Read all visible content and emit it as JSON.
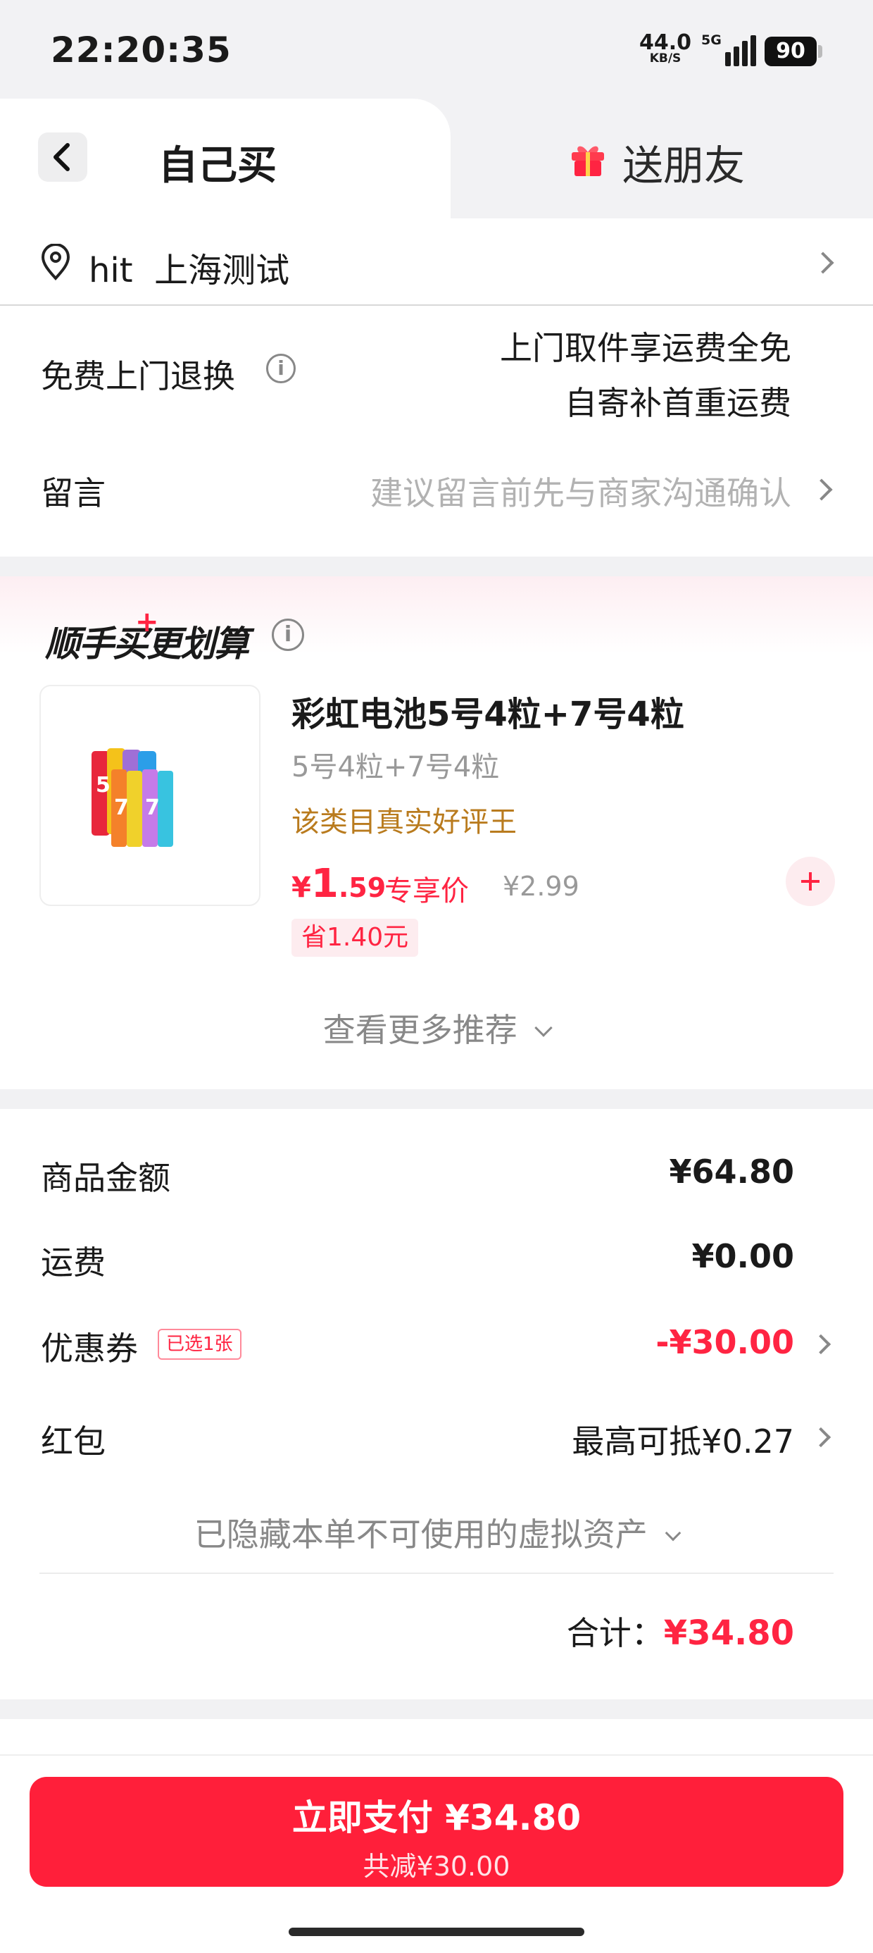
{
  "status_bar": {
    "time": "22:20:35",
    "net_speed": "44.0",
    "net_unit": "KB/S",
    "network": "5G",
    "battery": "90"
  },
  "tabs": {
    "self_buy": "自己买",
    "gift_friend": "送朋友"
  },
  "address": {
    "text": "hit  上海测试"
  },
  "return_service": {
    "label": "免费上门退换",
    "line1": "上门取件享运费全免",
    "line2": "自寄补首重运费"
  },
  "message": {
    "label": "留言",
    "placeholder": "建议留言前先与商家沟通确认"
  },
  "recommend": {
    "title": "顺手买更划算",
    "product": {
      "title": "彩虹电池5号4粒+7号4粒",
      "spec": "5号4粒+7号4粒",
      "tag": "该类目真实好评王",
      "price_currency": "¥",
      "price_int": "1",
      "price_dec": ".59",
      "price_label": "专享价",
      "original_price": "¥2.99",
      "save": "省1.40元"
    },
    "more": "查看更多推荐"
  },
  "summary": {
    "goods_label": "商品金额",
    "goods_value": "¥64.80",
    "shipping_label": "运费",
    "shipping_value": "¥0.00",
    "coupon_label": "优惠券",
    "coupon_badge": "已选1张",
    "coupon_value": "-¥30.00",
    "redpacket_label": "红包",
    "redpacket_value": "最高可抵¥0.27",
    "hidden_assets": "已隐藏本单不可使用的虚拟资产",
    "total_label": "合计：",
    "total_value": "¥34.80"
  },
  "pay": {
    "label": "立即支付 ¥34.80",
    "sub": "共减¥30.00"
  },
  "colors": {
    "accent": "#ff2442",
    "pay_button": "#ff1f3a",
    "tag_gold": "#b97b1e"
  }
}
